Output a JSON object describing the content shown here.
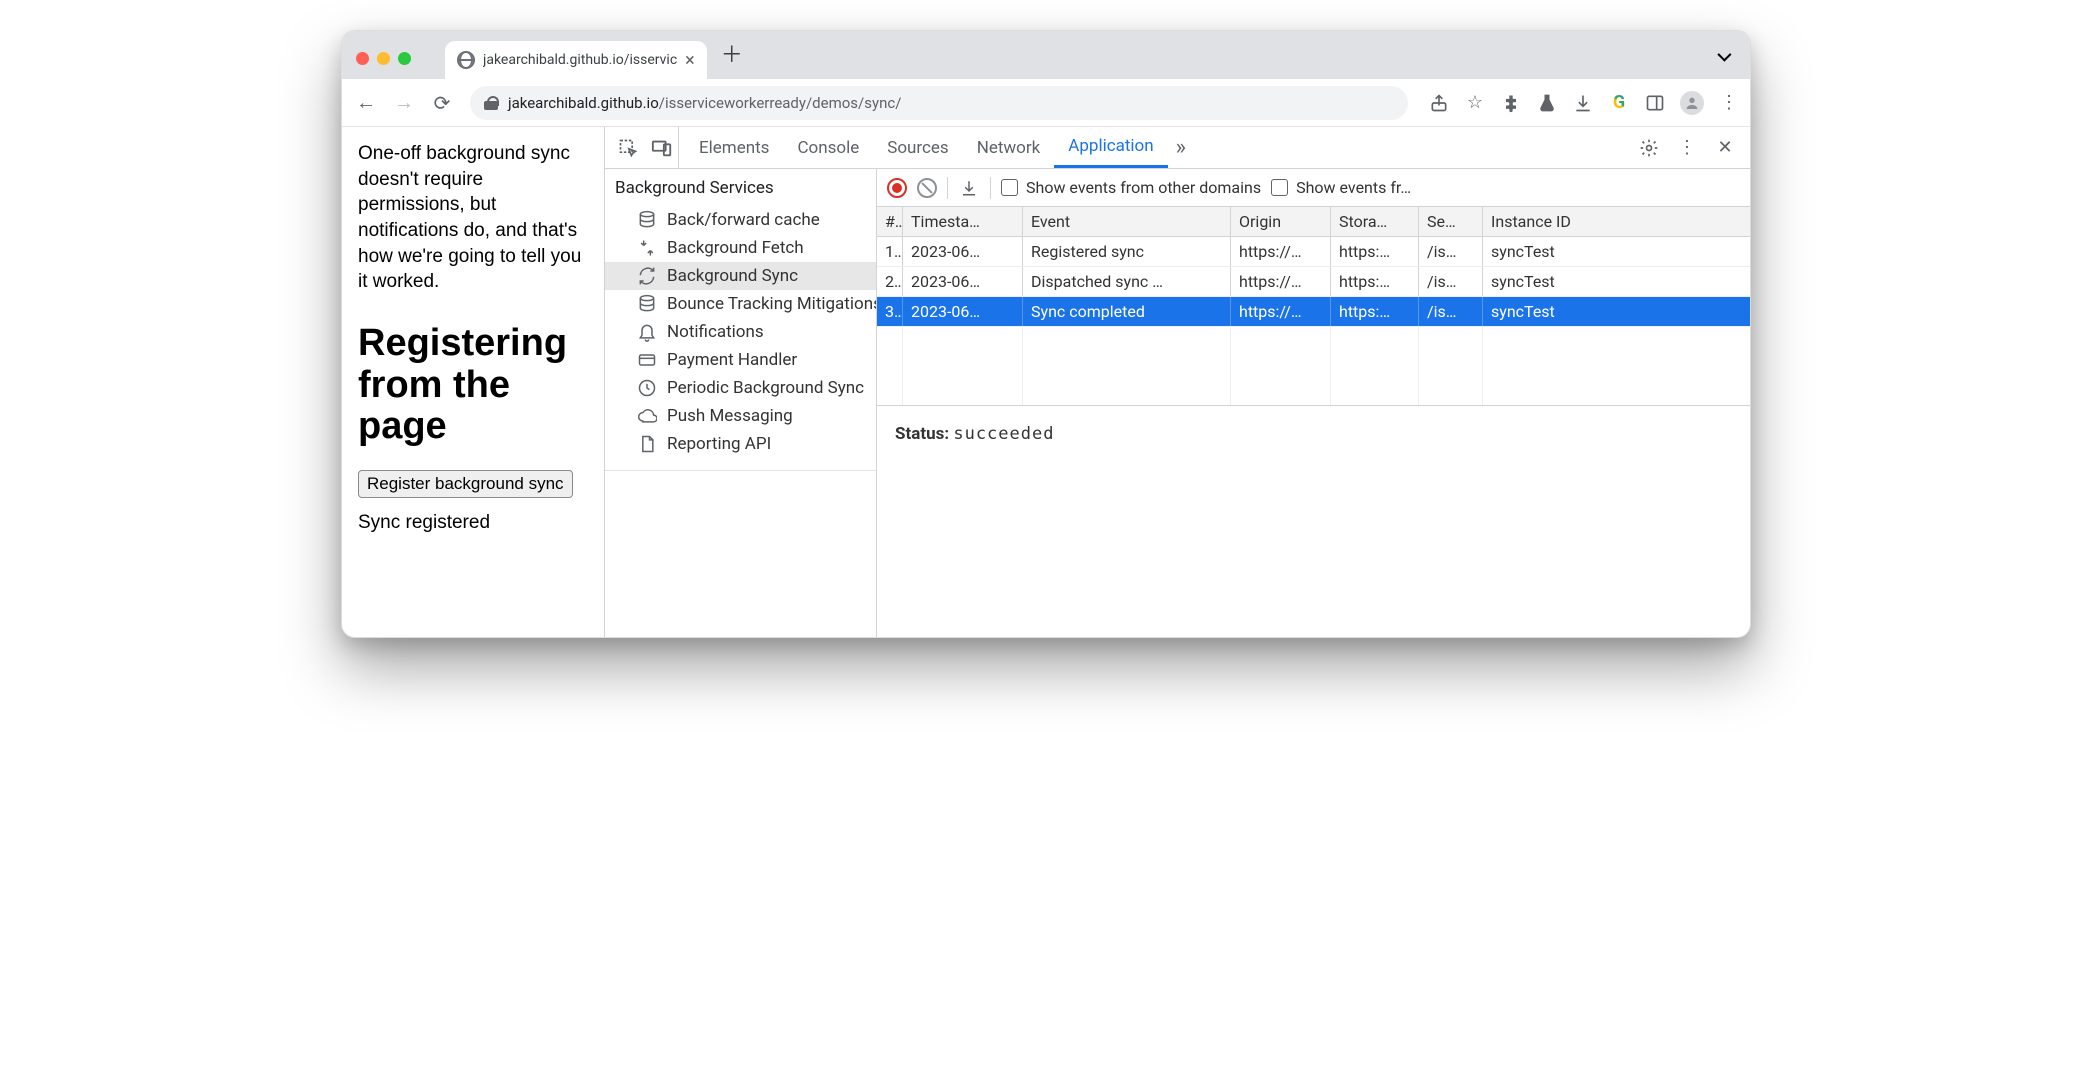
{
  "browser": {
    "tab_title": "jakearchibald.github.io/isservic",
    "url_host": "jakearchibald.github.io",
    "url_path": "/isserviceworkerready/demos/sync/"
  },
  "page": {
    "intro": "One-off background sync doesn't require permissions, but notifications do, and that's how we're going to tell you it worked.",
    "heading": "Registering from the page",
    "button_label": "Register background sync",
    "status_text": "Sync registered"
  },
  "devtools": {
    "tabs": [
      "Elements",
      "Console",
      "Sources",
      "Network",
      "Application"
    ],
    "active_tab": "Application",
    "sidebar": {
      "group_title": "Background Services",
      "items": [
        {
          "icon": "database",
          "label": "Back/forward cache"
        },
        {
          "icon": "fetch",
          "label": "Background Fetch"
        },
        {
          "icon": "sync",
          "label": "Background Sync",
          "selected": true
        },
        {
          "icon": "database",
          "label": "Bounce Tracking Mitigations"
        },
        {
          "icon": "bell",
          "label": "Notifications"
        },
        {
          "icon": "card",
          "label": "Payment Handler"
        },
        {
          "icon": "clock",
          "label": "Periodic Background Sync"
        },
        {
          "icon": "cloud",
          "label": "Push Messaging"
        },
        {
          "icon": "file",
          "label": "Reporting API"
        }
      ]
    },
    "events_toolbar": {
      "check1": "Show events from other domains",
      "check2": "Show events fr…"
    },
    "events_table": {
      "columns": [
        "#",
        "Timesta…",
        "Event",
        "Origin",
        "Stora…",
        "Se…",
        "Instance ID"
      ],
      "rows": [
        {
          "n": "1.",
          "ts": "2023-06…",
          "ev": "Registered sync",
          "or": "https://…",
          "st": "https:…",
          "sc": "/is…",
          "id": "syncTest"
        },
        {
          "n": "2.",
          "ts": "2023-06…",
          "ev": "Dispatched sync …",
          "or": "https://…",
          "st": "https:…",
          "sc": "/is…",
          "id": "syncTest"
        },
        {
          "n": "3.",
          "ts": "2023-06…",
          "ev": "Sync completed",
          "or": "https://…",
          "st": "https:…",
          "sc": "/is…",
          "id": "syncTest",
          "selected": true
        }
      ]
    },
    "status_label": "Status:",
    "status_value": "succeeded"
  }
}
